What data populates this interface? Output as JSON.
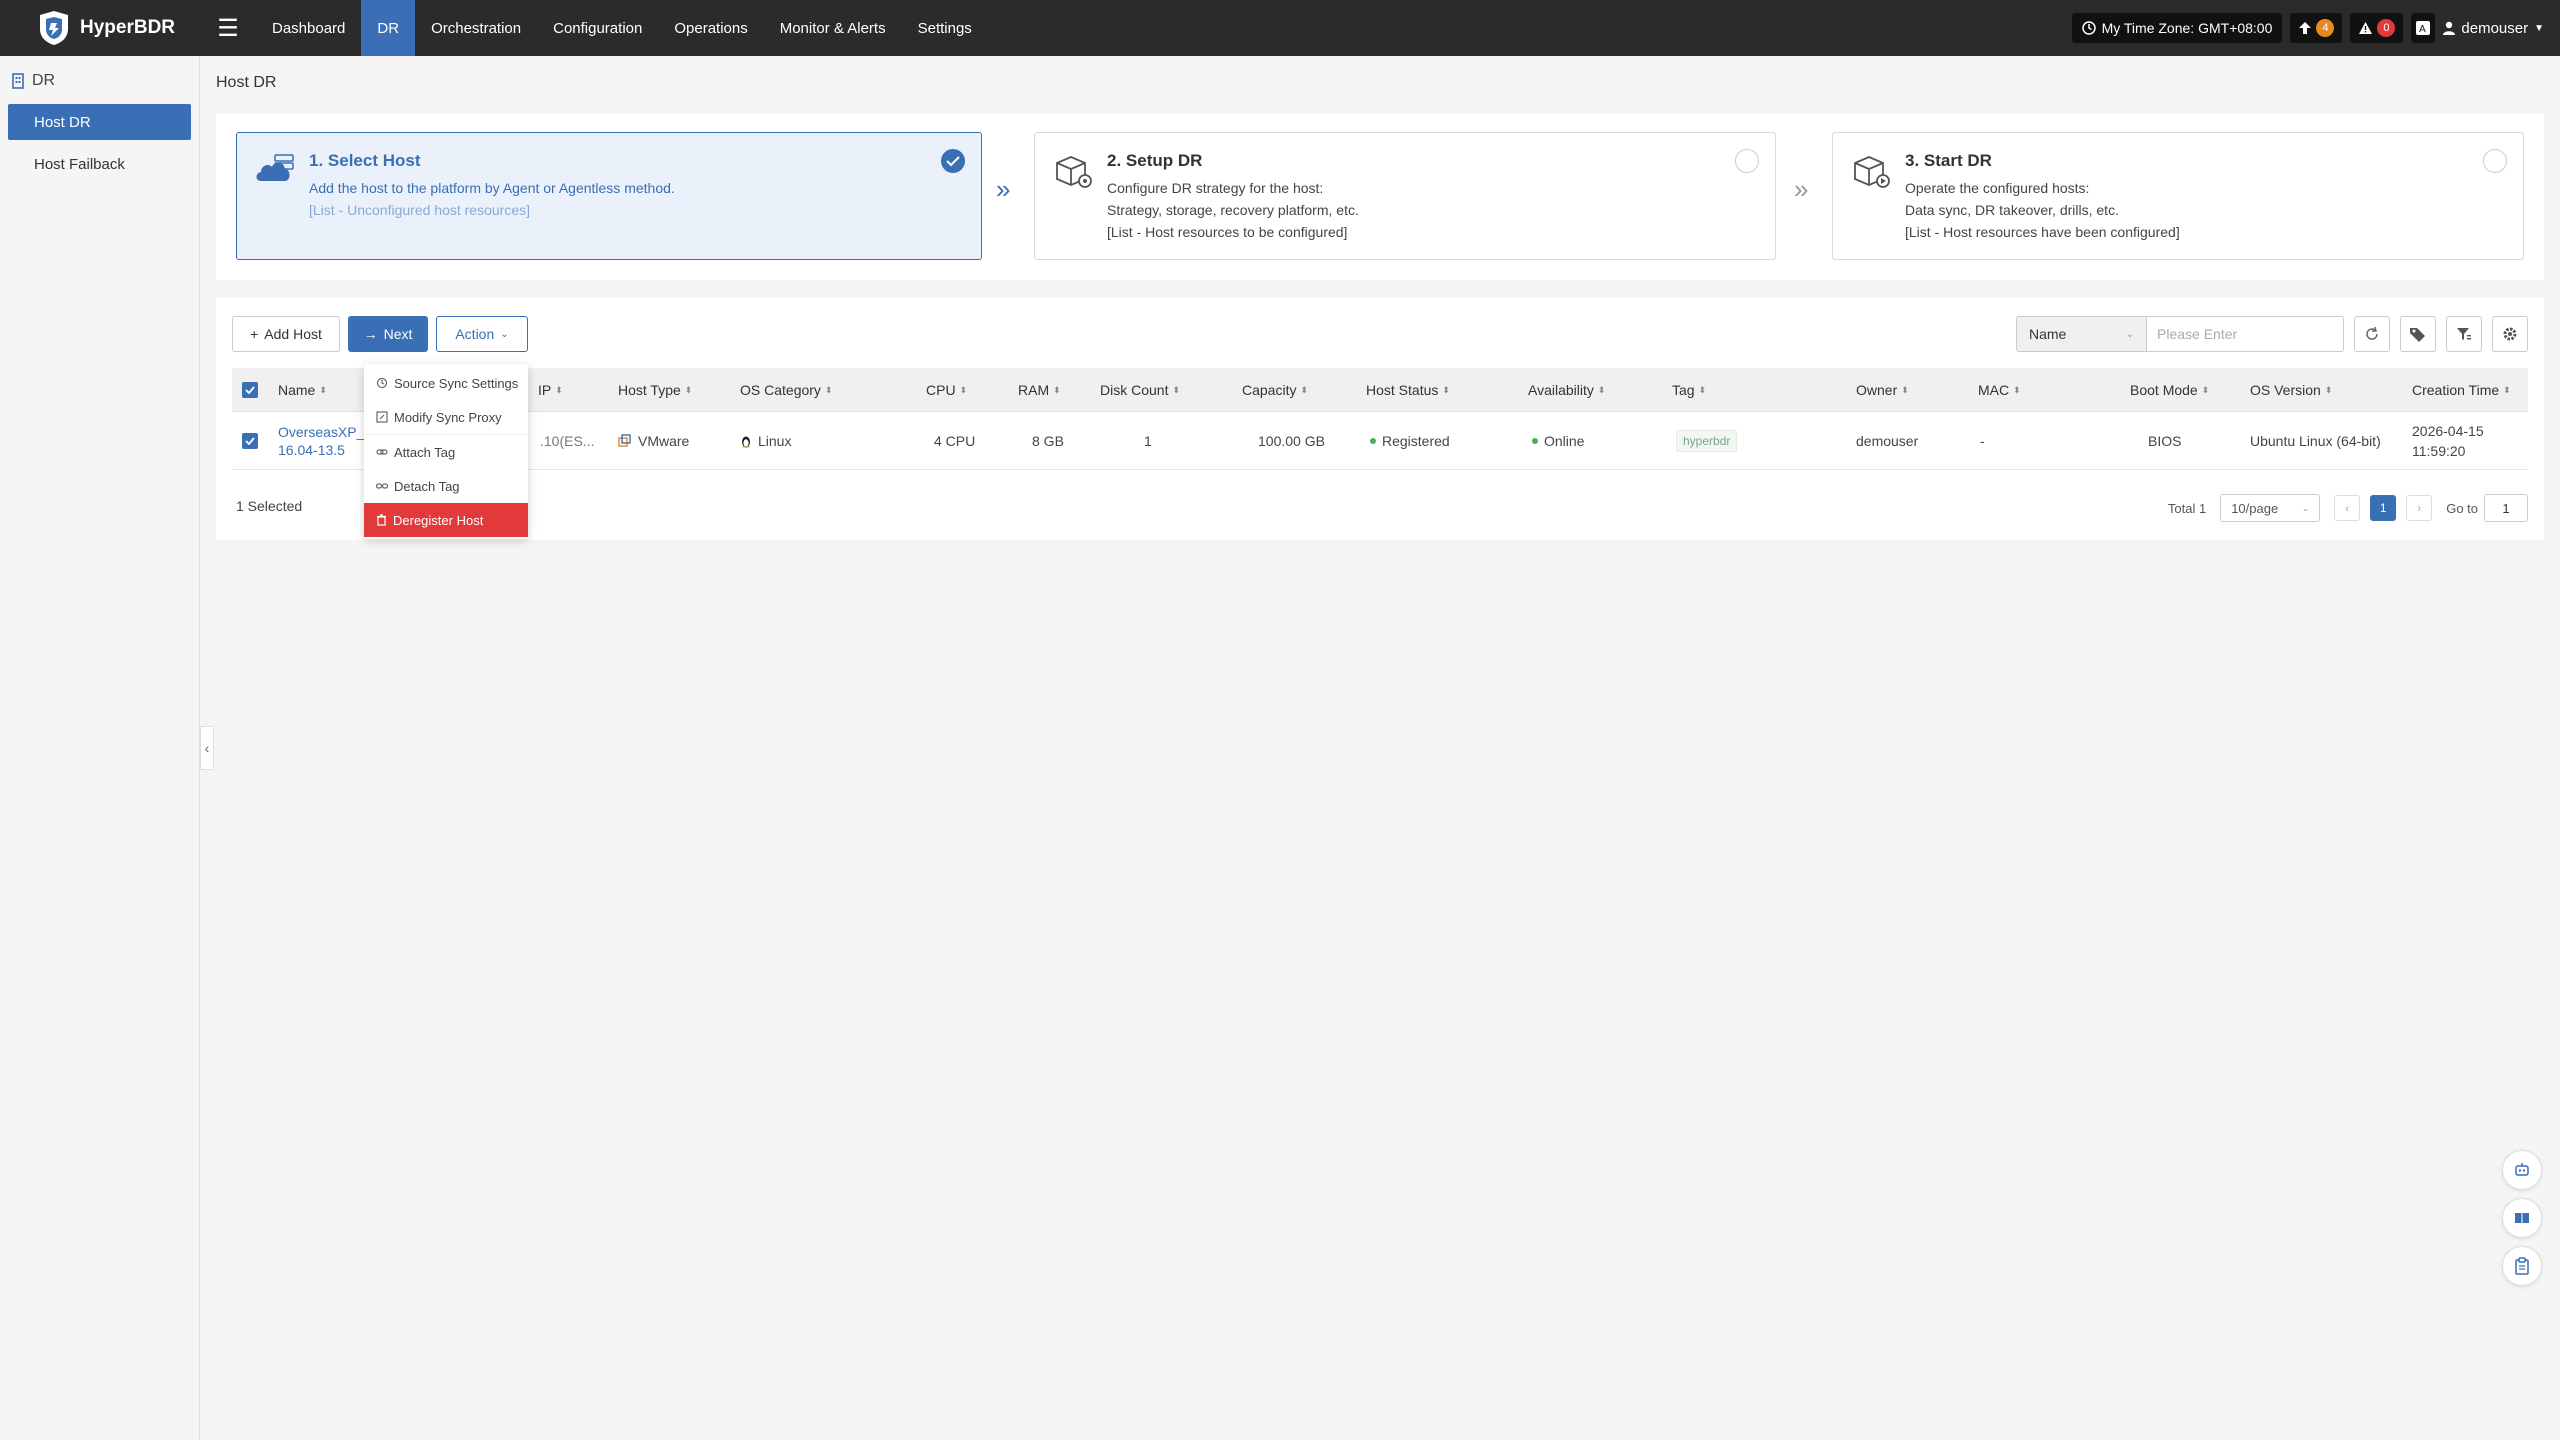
{
  "app": {
    "name": "HyperBDR"
  },
  "nav": {
    "items": [
      "Dashboard",
      "DR",
      "Orchestration",
      "Configuration",
      "Operations",
      "Monitor & Alerts",
      "Settings"
    ],
    "active": "DR",
    "timezone": "My Time Zone: GMT+08:00",
    "upload_count": "4",
    "alert_count": "0",
    "user": "demouser"
  },
  "sidebar": {
    "header": "DR",
    "items": [
      {
        "label": "Host DR",
        "active": true
      },
      {
        "label": "Host Failback",
        "active": false
      }
    ]
  },
  "page": {
    "title": "Host DR"
  },
  "steps": [
    {
      "title": "1. Select Host",
      "lines": [
        "Add the host to the platform by Agent or Agentless method.",
        "[List - Unconfigured host resources]"
      ],
      "done": true
    },
    {
      "title": "2. Setup DR",
      "lines": [
        "Configure DR strategy for the host:",
        "Strategy, storage, recovery platform, etc.",
        "[List - Host resources to be configured]"
      ],
      "done": false
    },
    {
      "title": "3. Start DR",
      "lines": [
        "Operate the configured hosts:",
        "Data sync, DR takeover, drills, etc.",
        "[List - Host resources have been configured]"
      ],
      "done": false
    }
  ],
  "toolbar": {
    "add_host": "Add Host",
    "next": "Next",
    "action": "Action",
    "search_field": "Name",
    "search_placeholder": "Please Enter"
  },
  "action_menu": {
    "items": [
      "Source Sync Settings",
      "Modify Sync Proxy",
      "Attach Tag",
      "Detach Tag",
      "Deregister Host"
    ]
  },
  "table": {
    "headers": [
      "Name",
      "IP",
      "Host Type",
      "OS Category",
      "CPU",
      "RAM",
      "Disk Count",
      "Capacity",
      "Host Status",
      "Availability",
      "Tag",
      "Owner",
      "MAC",
      "Boot Mode",
      "OS Version",
      "Creation Time"
    ],
    "rows": [
      {
        "name_line1": "OverseasXP_",
        "name_line2": "16.04-13.5",
        "ip": ".10(ES...",
        "host_type": "VMware",
        "os_category": "Linux",
        "cpu": "4 CPU",
        "ram": "8 GB",
        "disk_count": "1",
        "capacity": "100.00 GB",
        "host_status": "Registered",
        "availability": "Online",
        "tag": "hyperbdr",
        "owner": "demouser",
        "mac": "-",
        "boot_mode": "BIOS",
        "os_version": "Ubuntu Linux (64-bit)",
        "created_date": "2026-04-15",
        "created_time": "11:59:20"
      }
    ]
  },
  "footer": {
    "selected": "1 Selected",
    "total": "Total 1",
    "page_size": "10/page",
    "current_page": "1",
    "goto_label": "Go to",
    "goto_value": "1"
  },
  "colors": {
    "accent": "#3a6fb5",
    "danger": "#e23a3a",
    "warning": "#e8891f",
    "success": "#48b050",
    "topbar": "#2b2b2b"
  }
}
